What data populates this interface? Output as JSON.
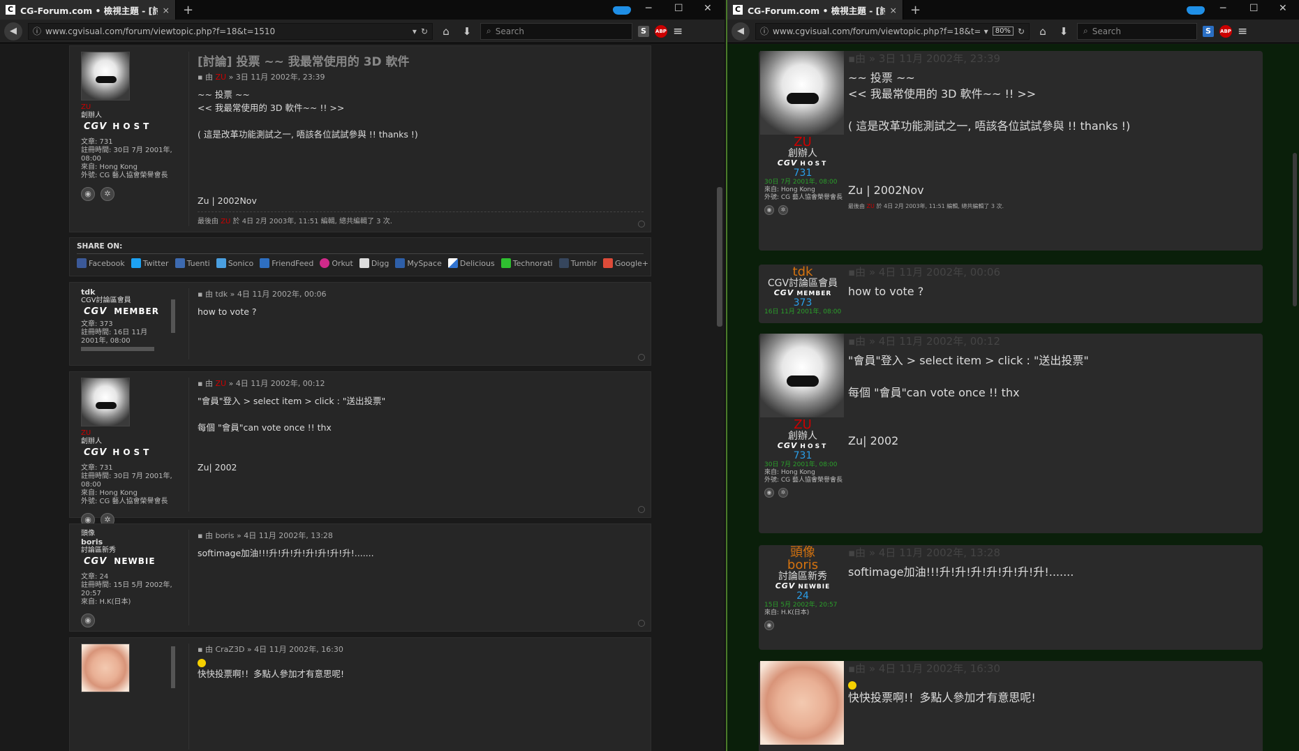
{
  "tab": {
    "favicon": "C",
    "title": "CG-Forum.com • 檢視主題 - [討論...",
    "close": "×",
    "new": "+"
  },
  "wc": {
    "min": "─",
    "max": "☐",
    "close": "✕"
  },
  "nav": {
    "url_left": "www.cgvisual.com/forum/viewtopic.php?f=18&t=1510",
    "url_right": "www.cgvisual.com/forum/viewtopic.php?f=18&t=1510",
    "zoom": "80%",
    "search_placeholder": "Search",
    "s_label": "S",
    "abp_label": "ABP"
  },
  "colors": {
    "accent_blue": "#1f8fe6",
    "author_red": "#c00000",
    "frame_green": "#4a7a2a",
    "orange": "#d5730f",
    "count_blue": "#2a9ee8",
    "date_green": "#2aa02a"
  },
  "share": {
    "heading": "SHARE ON:",
    "items": [
      "Facebook",
      "Twitter",
      "Tuenti",
      "Sonico",
      "FriendFeed",
      "Orkut",
      "Digg",
      "MySpace",
      "Delicious",
      "Technorati",
      "Tumblr",
      "Google+"
    ]
  },
  "left": {
    "post1": {
      "name": "ZU",
      "rank": "創辦人",
      "cgv": "CGV",
      "badge": "HOST",
      "info": "文章: 731\n註冊時間: 30日 7月 2001年, 08:00\n來自: Hong Kong\n外號: CG 藝人協會榮譽會長",
      "title": "[討論] 投票 ~~ 我最常使用的 3D 軟件",
      "meta_by": "由",
      "meta_author": "ZU",
      "meta_date": "» 3日 11月 2002年, 23:39",
      "text": "~~ 投票 ~~\n<< 我最常使用的 3D 軟件~~ !! >>\n\n( 這是改革功能測試之一, 唔該各位試試參與 !! thanks !)\n\n\n\n\nZu | 2002Nov",
      "edit_pre": "最後由",
      "edit_author": "ZU",
      "edit_post": "於 4日 2月 2003年, 11:51 編輯, 總共編輯了 3 次."
    },
    "post2": {
      "name": "tdk",
      "rank": "CGV討論區會員",
      "cgv": "CGV",
      "badge": "MEMBER",
      "info": "文章: 373\n註冊時間: 16日 11月 2001年, 08:00",
      "meta_by": "由",
      "meta_author": "tdk",
      "meta_date": "» 4日 11月 2002年, 00:06",
      "text": "how to vote ?"
    },
    "post3": {
      "name": "ZU",
      "rank": "創辦人",
      "cgv": "CGV",
      "badge": "HOST",
      "info": "文章: 731\n註冊時間: 30日 7月 2001年, 08:00\n來自: Hong Kong\n外號: CG 藝人協會榮譽會長",
      "meta_by": "由",
      "meta_author": "ZU",
      "meta_date": "» 4日 11月 2002年, 00:12",
      "text": "\"會員\"登入 > select item > click : \"送出投票\"\n\n每個 \"會員\"can vote once !! thx\n\n\nZu| 2002"
    },
    "post4": {
      "label": "頭像",
      "name": "boris",
      "rank": "討論區新秀",
      "cgv": "CGV",
      "badge": "NEWBIE",
      "info": "文章: 24\n註冊時間: 15日 5月 2002年, 20:57\n來自: H.K(日本)",
      "meta_by": "由",
      "meta_author": "boris",
      "meta_date": "» 4日 11月 2002年, 13:28",
      "text": "softimage加油!!!升!升!升!升!升!升!升!......."
    },
    "post5": {
      "meta_by": "由",
      "meta_author": "CraZ3D",
      "meta_date": "» 4日 11月 2002年, 16:30",
      "text": "快快投票啊!！多點人參加才有意思呢!"
    }
  },
  "right": {
    "post1": {
      "name": "ZU",
      "rank": "創辦人",
      "cgv": "CGV",
      "badge": "HOST",
      "count": "731",
      "date": "30日 7月 2001年, 08:00",
      "from": "來自: Hong Kong",
      "nick": "外號: CG 藝人協會榮譽會長",
      "meta": "由 » 3日 11月 2002年, 23:39",
      "text": "~~ 投票 ~~\n<< 我最常使用的 3D 軟件~~ !! >>\n\n( 這是改革功能測試之一, 唔該各位試試參與 !! thanks !)\n\n\n\nZu | 2002Nov",
      "edit_pre": "最後由",
      "edit_author": "ZU",
      "edit_post": "於 4日 2月 2003年, 11:51 編輯, 總共編輯了 3 次."
    },
    "post2": {
      "name": "tdk",
      "rank": "CGV討論區會員",
      "cgv": "CGV",
      "badge": "MEMBER",
      "count": "373",
      "date": "16日 11月 2001年, 08:00",
      "meta": "由 » 4日 11月 2002年, 00:06",
      "text": "how to vote ?"
    },
    "post3": {
      "name": "ZU",
      "rank": "創辦人",
      "cgv": "CGV",
      "badge": "HOST",
      "count": "731",
      "date": "30日 7月 2001年, 08:00",
      "from": "來自: Hong Kong",
      "nick": "外號: CG 藝人協會榮譽會長",
      "meta": "由 » 4日 11月 2002年, 00:12",
      "text": "\"會員\"登入 > select item > click : \"送出投票\"\n\n每個 \"會員\"can vote once !! thx\n\n\nZu| 2002"
    },
    "post4": {
      "label": "頭像",
      "name": "boris",
      "rank": "討論區新秀",
      "cgv": "CGV",
      "badge": "NEWBIE",
      "count": "24",
      "date": "15日 5月 2002年, 20:57",
      "from": "來自: H.K(日本)",
      "meta": "由 » 4日 11月 2002年, 13:28",
      "text": "softimage加油!!!升!升!升!升!升!升!升!......."
    },
    "post5": {
      "meta": "由 » 4日 11月 2002年, 16:30",
      "text": "快快投票啊!！多點人參加才有意思呢!"
    }
  }
}
